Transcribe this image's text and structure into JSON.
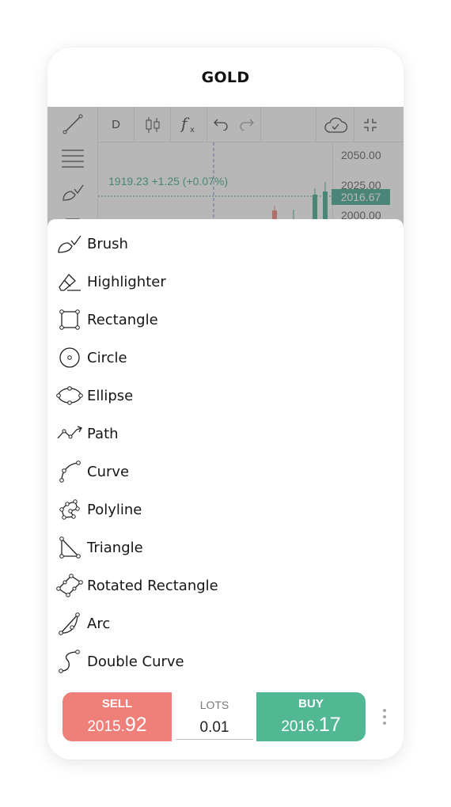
{
  "header": {
    "title": "GOLD"
  },
  "chart": {
    "interval": "D",
    "ohlc_line": "1919.23  +1.25 (+0.07%)",
    "price_scale": [
      "2050.00",
      "2025.00",
      "2000.00"
    ],
    "last_price": "2016.67",
    "colors": {
      "up": "#3aa58a",
      "down": "#ef7f79"
    },
    "left_toolbar_icons": [
      "trend-line-icon",
      "fib-levels-icon",
      "brush-icon",
      "ruler-icon"
    ],
    "top_toolbar_icons": [
      "candles-icon",
      "indicators-icon",
      "undo-icon",
      "redo-icon",
      "cloud-save-icon",
      "collapse-icon"
    ]
  },
  "drawing_tools": {
    "items": [
      {
        "label": "Brush",
        "icon": "brush-icon"
      },
      {
        "label": "Highlighter",
        "icon": "highlighter-icon"
      },
      {
        "label": "Rectangle",
        "icon": "rectangle-icon"
      },
      {
        "label": "Circle",
        "icon": "circle-icon"
      },
      {
        "label": "Ellipse",
        "icon": "ellipse-icon"
      },
      {
        "label": "Path",
        "icon": "path-icon"
      },
      {
        "label": "Curve",
        "icon": "curve-icon"
      },
      {
        "label": "Polyline",
        "icon": "polyline-icon"
      },
      {
        "label": "Triangle",
        "icon": "triangle-icon"
      },
      {
        "label": "Rotated Rectangle",
        "icon": "rotated-rectangle-icon"
      },
      {
        "label": "Arc",
        "icon": "arc-icon"
      },
      {
        "label": "Double Curve",
        "icon": "double-curve-icon"
      }
    ]
  },
  "trade": {
    "sell_label": "SELL",
    "sell_price_main": "2015.",
    "sell_price_big": "92",
    "lots_label": "LOTS",
    "lots_value": "0.01",
    "buy_label": "BUY",
    "buy_price_main": "2016.",
    "buy_price_big": "17",
    "sell_color": "#ef7f79",
    "buy_color": "#51b893"
  }
}
